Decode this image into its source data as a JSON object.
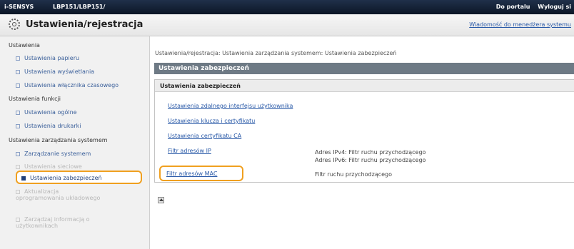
{
  "topbar": {
    "brand": "i-SENSYS",
    "model": "LBP151/LBP151/",
    "link_portal": "Do portalu",
    "link_logout": "Wyloguj si"
  },
  "header": {
    "title": "Ustawienia/rejestracja",
    "message_link": "Wiadomość do menedżera systemu"
  },
  "sidebar": {
    "section1_title": "Ustawienia",
    "item_paper": "Ustawienia papieru",
    "item_display": "Ustawienia wyświetlania",
    "item_timer": "Ustawienia włącznika czasowego",
    "section2_title": "Ustawienia funkcji",
    "item_general": "Ustawienia ogólne",
    "item_printer": "Ustawienia drukarki",
    "section3_title": "Ustawienia zarządzania systemem",
    "item_system": "Zarządzanie systemem",
    "item_network": "Ustawienia sieciowe",
    "item_security": "Ustawienia zabezpieczeń",
    "item_firmware": "Aktualizacja oprogramowania układowego",
    "item_info": "Zarządzaj informacją o użytkownikach"
  },
  "main": {
    "breadcrumb": "Ustawienia/rejestracja: Ustawienia zarządzania systemem: Ustawienia zabezpieczeń",
    "page_title": "Ustawienia zabezpieczeń",
    "panel_title": "Ustawienia zabezpieczeń",
    "link_remote_ui": "Ustawienia zdalnego interfejsu użytkownika",
    "link_keys": "Ustawienia klucza i certyfikatu",
    "link_ca": "Ustawienia certyfikatu CA",
    "link_ip_filter": "Filtr adresów IP",
    "ip_desc_1": "Adres IPv4: Filtr ruchu przychodzącego",
    "ip_desc_2": "Adres IPv6: Filtr ruchu przychodzącego",
    "link_mac_filter": "Filtr adresów MAC",
    "mac_desc": "Filtr ruchu przychodzącego"
  },
  "colors": {
    "highlight": "#f0a020",
    "link": "#2a5aa8",
    "page_bar": "#6e7a85"
  }
}
